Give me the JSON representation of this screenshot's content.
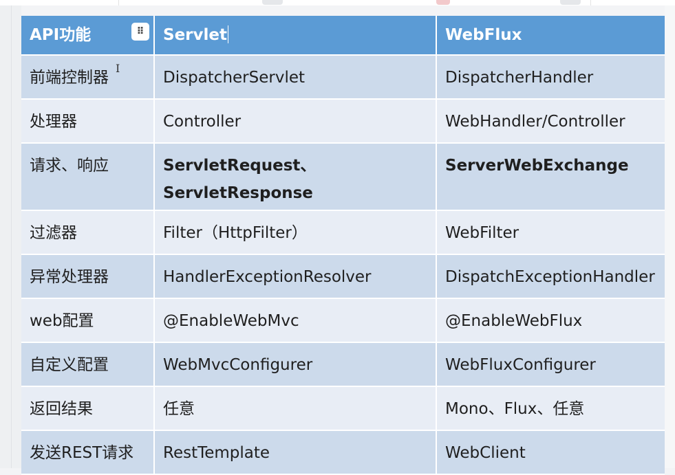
{
  "table": {
    "headers": [
      "API功能",
      "Servlet",
      "WebFlux"
    ],
    "rows": [
      [
        "前端控制器",
        "DispatcherServlet",
        "DispatcherHandler"
      ],
      [
        "处理器",
        "Controller",
        "WebHandler/Controller"
      ],
      [
        "请求、响应",
        "ServletRequest、ServletResponse",
        "ServerWebExchange"
      ],
      [
        "过滤器",
        "Filter（HttpFilter）",
        "WebFilter"
      ],
      [
        "异常处理器",
        "HandlerExceptionResolver",
        "DispatchExceptionHandler"
      ],
      [
        "web配置",
        "@EnableWebMvc",
        "@EnableWebFlux"
      ],
      [
        "自定义配置",
        "WebMvcConfigurer",
        "WebFluxConfigurer"
      ],
      [
        "返回结果",
        "任意",
        "Mono、Flux、任意"
      ],
      [
        "发送REST请求",
        "RestTemplate",
        "WebClient"
      ]
    ]
  },
  "colors": {
    "header_bg": "#5b9bd5",
    "row_odd_bg": "#ccdaeb",
    "row_even_bg": "#e8edf5"
  },
  "icons": {
    "drag_handle": "drag-handle-icon",
    "text_cursor": "text-cursor-icon"
  }
}
